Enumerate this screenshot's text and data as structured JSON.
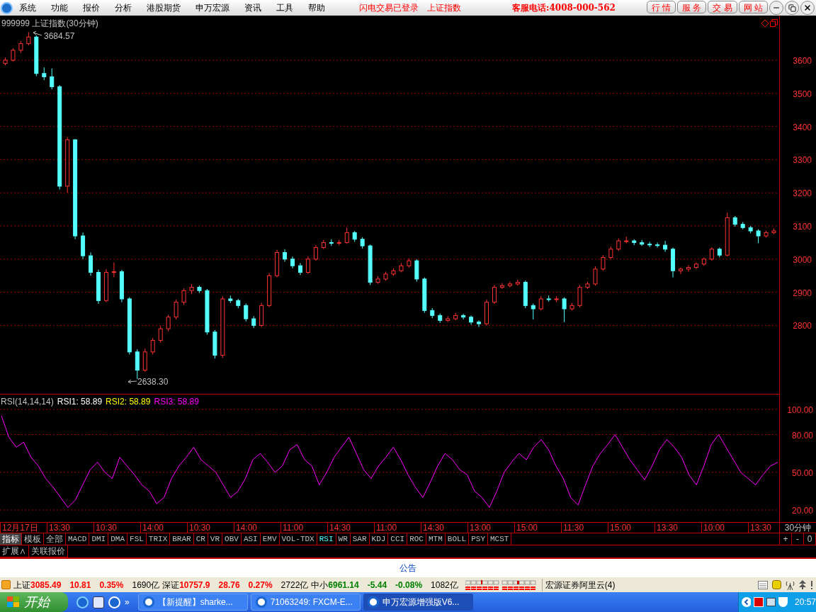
{
  "menu": {
    "items": [
      "系统",
      "功能",
      "报价",
      "分析",
      "港股期货",
      "申万宏源",
      "资讯",
      "工具",
      "帮助"
    ],
    "login_status": "闪电交易已登录",
    "index_name": "上证指数",
    "hotline": "客服电话:4008-000-562",
    "nav_buttons": [
      "行 情",
      "服 务",
      "交 易",
      "网 站"
    ]
  },
  "chart": {
    "title": "999999 上证指数(30分钟)",
    "high_label": "3684.57",
    "low_label": "2638.30",
    "chart_data": {
      "type": "candlestick",
      "grid": true,
      "ylim": [
        2591.5,
        3734.6
      ],
      "yticks": [
        {
          "value": 3600,
          "label": "3600"
        },
        {
          "value": 3500,
          "label": "3500"
        },
        {
          "value": 3400,
          "label": "3400"
        },
        {
          "value": 3300,
          "label": "3300"
        },
        {
          "value": 3200,
          "label": "3200"
        },
        {
          "value": 3100,
          "label": "3100"
        },
        {
          "value": 3000,
          "label": "3000"
        },
        {
          "value": 2900,
          "label": "2900"
        },
        {
          "value": 2800,
          "label": "2800"
        }
      ],
      "ohlc": [
        [
          3590,
          3608,
          3585,
          3600
        ],
        [
          3600,
          3636,
          3596,
          3630
        ],
        [
          3630,
          3658,
          3622,
          3650
        ],
        [
          3650,
          3684.57,
          3645,
          3670
        ],
        [
          3670,
          3675,
          3552,
          3560
        ],
        [
          3560,
          3578,
          3540,
          3550
        ],
        [
          3550,
          3575,
          3512,
          3520
        ],
        [
          3520,
          3525,
          3210,
          3220
        ],
        [
          3220,
          3368,
          3200,
          3360
        ],
        [
          3360,
          3362,
          3060,
          3070
        ],
        [
          3070,
          3080,
          3000,
          3010
        ],
        [
          3010,
          3020,
          2950,
          2960
        ],
        [
          2960,
          2968,
          2865,
          2875
        ],
        [
          2875,
          2970,
          2870,
          2960
        ],
        [
          2960,
          2990,
          2945,
          2962
        ],
        [
          2962,
          2968,
          2870,
          2880
        ],
        [
          2880,
          2885,
          2712,
          2720
        ],
        [
          2720,
          2728,
          2638.3,
          2665
        ],
        [
          2665,
          2730,
          2660,
          2720
        ],
        [
          2720,
          2762,
          2712,
          2755
        ],
        [
          2755,
          2798,
          2748,
          2790
        ],
        [
          2790,
          2832,
          2782,
          2825
        ],
        [
          2825,
          2878,
          2818,
          2870
        ],
        [
          2870,
          2912,
          2862,
          2905
        ],
        [
          2905,
          2925,
          2895,
          2915
        ],
        [
          2915,
          2920,
          2898,
          2905
        ],
        [
          2905,
          2910,
          2772,
          2780
        ],
        [
          2780,
          2786,
          2700,
          2710
        ],
        [
          2710,
          2888,
          2702,
          2880
        ],
        [
          2880,
          2890,
          2868,
          2875
        ],
        [
          2875,
          2880,
          2852,
          2860
        ],
        [
          2860,
          2866,
          2812,
          2820
        ],
        [
          2820,
          2828,
          2792,
          2800
        ],
        [
          2800,
          2868,
          2795,
          2860
        ],
        [
          2860,
          2958,
          2855,
          2950
        ],
        [
          2950,
          3028,
          2945,
          3020
        ],
        [
          3020,
          3030,
          2992,
          3000
        ],
        [
          3000,
          3008,
          2972,
          2980
        ],
        [
          2980,
          2988,
          2952,
          2960
        ],
        [
          2960,
          3008,
          2955,
          3000
        ],
        [
          3000,
          3042,
          2995,
          3035
        ],
        [
          3035,
          3058,
          3030,
          3050
        ],
        [
          3050,
          3060,
          3040,
          3048
        ],
        [
          3048,
          3058,
          3042,
          3050
        ],
        [
          3050,
          3095,
          3046,
          3080
        ],
        [
          3080,
          3085,
          3052,
          3060
        ],
        [
          3060,
          3066,
          3032,
          3040
        ],
        [
          3040,
          3044,
          2922,
          2930
        ],
        [
          2930,
          2948,
          2925,
          2940
        ],
        [
          2940,
          2962,
          2935,
          2955
        ],
        [
          2955,
          2972,
          2950,
          2965
        ],
        [
          2965,
          2988,
          2960,
          2980
        ],
        [
          2980,
          3002,
          2975,
          2995
        ],
        [
          2995,
          3000,
          2932,
          2940
        ],
        [
          2940,
          2945,
          2838,
          2845
        ],
        [
          2845,
          2852,
          2822,
          2830
        ],
        [
          2830,
          2836,
          2808,
          2815
        ],
        [
          2815,
          2828,
          2810,
          2820
        ],
        [
          2820,
          2838,
          2815,
          2830
        ],
        [
          2830,
          2835,
          2818,
          2825
        ],
        [
          2825,
          2830,
          2802,
          2810
        ],
        [
          2810,
          2815,
          2795,
          2805
        ],
        [
          2805,
          2878,
          2800,
          2870
        ],
        [
          2870,
          2922,
          2865,
          2915
        ],
        [
          2915,
          2928,
          2910,
          2920
        ],
        [
          2920,
          2932,
          2915,
          2925
        ],
        [
          2925,
          2938,
          2920,
          2930
        ],
        [
          2930,
          2935,
          2852,
          2860
        ],
        [
          2860,
          2866,
          2818,
          2850
        ],
        [
          2850,
          2888,
          2845,
          2880
        ],
        [
          2880,
          2890,
          2872,
          2878
        ],
        [
          2878,
          2888,
          2870,
          2880
        ],
        [
          2880,
          2885,
          2810,
          2850
        ],
        [
          2850,
          2868,
          2845,
          2860
        ],
        [
          2860,
          2922,
          2855,
          2915
        ],
        [
          2915,
          2932,
          2910,
          2925
        ],
        [
          2925,
          2978,
          2920,
          2970
        ],
        [
          2970,
          3012,
          2965,
          3005
        ],
        [
          3005,
          3038,
          3000,
          3030
        ],
        [
          3030,
          3062,
          3025,
          3055
        ],
        [
          3055,
          3068,
          3048,
          3055
        ],
        [
          3055,
          3060,
          3042,
          3050
        ],
        [
          3050,
          3058,
          3040,
          3045
        ],
        [
          3045,
          3052,
          3036,
          3043
        ],
        [
          3043,
          3050,
          3035,
          3042
        ],
        [
          3042,
          3055,
          3022,
          3030
        ],
        [
          3030,
          3035,
          2945,
          2965
        ],
        [
          2965,
          2975,
          2955,
          2970
        ],
        [
          2970,
          2982,
          2962,
          2975
        ],
        [
          2975,
          2990,
          2970,
          2985
        ],
        [
          2985,
          3005,
          2980,
          3000
        ],
        [
          3000,
          3036,
          2995,
          3030
        ],
        [
          3030,
          3035,
          3005,
          3012
        ],
        [
          3012,
          3140,
          3008,
          3125
        ],
        [
          3125,
          3130,
          3098,
          3105
        ],
        [
          3105,
          3112,
          3090,
          3095
        ],
        [
          3095,
          3100,
          3078,
          3085
        ],
        [
          3085,
          3090,
          3048,
          3070
        ],
        [
          3070,
          3086,
          3065,
          3080
        ],
        [
          3080,
          3092,
          3075,
          3085
        ]
      ]
    }
  },
  "rsi": {
    "title": "RSI(14,14,14)",
    "values": [
      {
        "label": "RSI1: 58.89"
      },
      {
        "label": "RSI2: 58.89"
      },
      {
        "label": "RSI3: 58.89"
      }
    ],
    "chart_data": {
      "type": "line",
      "grid": true,
      "ylim": [
        20,
        100
      ],
      "yticks": [
        {
          "value": 100,
          "label": "100.00"
        },
        {
          "value": 80,
          "label": "80.00"
        },
        {
          "value": 50,
          "label": "50.00"
        },
        {
          "value": 20,
          "label": "20.00"
        }
      ],
      "series": [
        {
          "color": "#ff00ff",
          "values": [
            95,
            78,
            70,
            74,
            62,
            55,
            45,
            38,
            30,
            22,
            28,
            40,
            52,
            58,
            50,
            45,
            62,
            55,
            48,
            40,
            35,
            25,
            30,
            45,
            55,
            62,
            70,
            60,
            55,
            50,
            40,
            30,
            35,
            45,
            60,
            65,
            58,
            50,
            55,
            68,
            72,
            60,
            55,
            40,
            50,
            62,
            70,
            78,
            65,
            52,
            45,
            55,
            62,
            70,
            60,
            48,
            38,
            30,
            42,
            55,
            65,
            60,
            52,
            48,
            35,
            30,
            22,
            35,
            50,
            58,
            65,
            60,
            70,
            76,
            68,
            55,
            45,
            30,
            24,
            40,
            55,
            65,
            72,
            80,
            70,
            60,
            52,
            44,
            55,
            68,
            76,
            70,
            62,
            48,
            40,
            55,
            72,
            80,
            70,
            60,
            50,
            45,
            40,
            48,
            55,
            58
          ]
        }
      ]
    }
  },
  "time_axis": {
    "labels": [
      "12月17日",
      "13:30",
      "10:30",
      "14:00",
      "10:30",
      "14:00",
      "11:00",
      "14:30",
      "11:00",
      "14:30",
      "13:00",
      "15:00",
      "11:30",
      "15:00",
      "13:30",
      "10:00",
      "13:30"
    ],
    "unit": "30分钟"
  },
  "left_tabs": [
    {
      "label": "指标",
      "selected": true
    },
    {
      "label": "模板",
      "selected": false
    },
    {
      "label": "全部",
      "selected": false
    }
  ],
  "indicator_tabs": [
    {
      "label": "MACD",
      "selected": false
    },
    {
      "label": "DMI",
      "selected": false
    },
    {
      "label": "DMA",
      "selected": false
    },
    {
      "label": "FSL",
      "selected": false
    },
    {
      "label": "TRIX",
      "selected": false
    },
    {
      "label": "BRAR",
      "selected": false
    },
    {
      "label": "CR",
      "selected": false
    },
    {
      "label": "VR",
      "selected": false
    },
    {
      "label": "OBV",
      "selected": false
    },
    {
      "label": "ASI",
      "selected": false
    },
    {
      "label": "EMV",
      "selected": false
    },
    {
      "label": "VOL-TDX",
      "selected": false
    },
    {
      "label": "RSI",
      "selected": true
    },
    {
      "label": "WR",
      "selected": false
    },
    {
      "label": "SAR",
      "selected": false
    },
    {
      "label": "KDJ",
      "selected": false
    },
    {
      "label": "CCI",
      "selected": false
    },
    {
      "label": "ROC",
      "selected": false
    },
    {
      "label": "MTM",
      "selected": false
    },
    {
      "label": "BOLL",
      "selected": false
    },
    {
      "label": "PSY",
      "selected": false
    },
    {
      "label": "MCST",
      "selected": false
    }
  ],
  "zoom_buttons": [
    "+",
    "-",
    "0"
  ],
  "ext_tabs": [
    "扩展∧",
    "关联报价"
  ],
  "notice": "公告",
  "status_bar": {
    "markets": [
      {
        "name": "上证",
        "value": "3085.49",
        "change": "10.81",
        "pct": "0.35%",
        "volume": "1690亿",
        "rising": true
      },
      {
        "name": "深证",
        "value": "10757.9",
        "change": "28.76",
        "pct": "0.27%",
        "volume": "2722亿",
        "rising": true
      },
      {
        "name": "中小",
        "value": "6961.14",
        "change": "-5.44",
        "pct": "-0.08%",
        "volume": "1082亿",
        "rising": false
      }
    ],
    "server": "宏源证券阿里云(4)"
  },
  "taskbar": {
    "start": "开始",
    "quick_more": "»",
    "tasks": [
      {
        "label": "【新提醒】sharke...",
        "selected": false
      },
      {
        "label": "71063249: FXCM-E...",
        "selected": false
      },
      {
        "label": "申万宏源增强版V6...",
        "selected": true
      }
    ],
    "clock": "20:57"
  }
}
